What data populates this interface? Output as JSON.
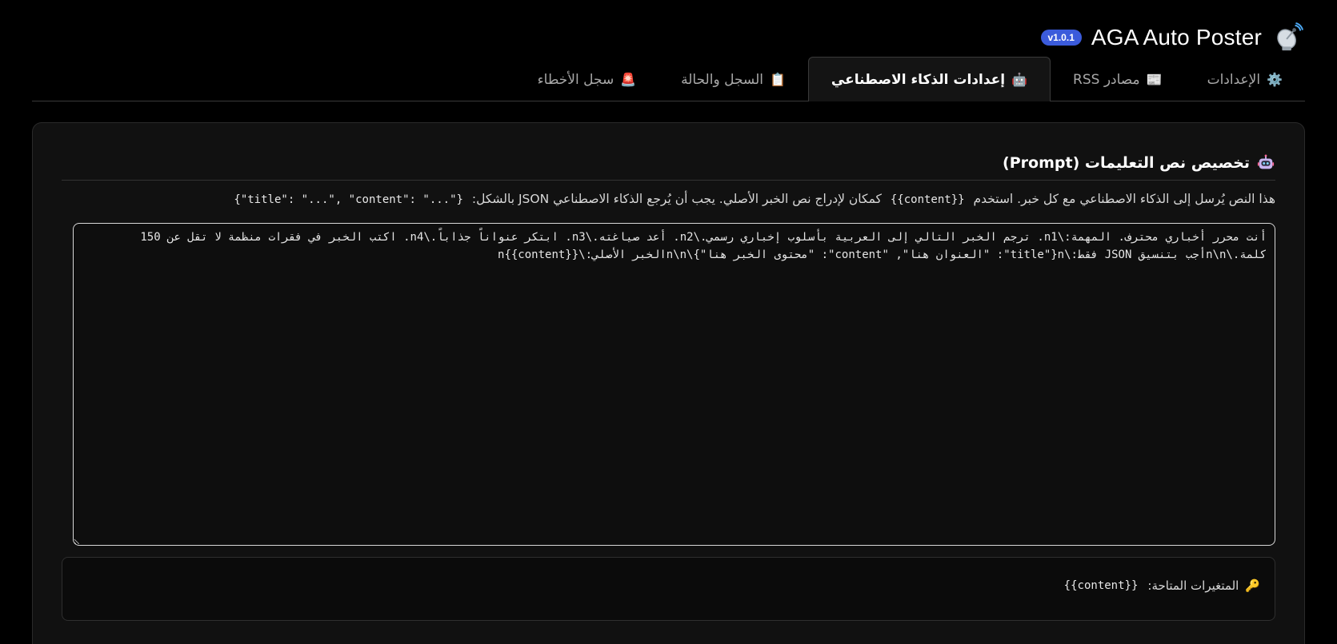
{
  "header": {
    "title": "AGA Auto Poster",
    "version": "v1.0.1",
    "icon": "satellite-dish-icon"
  },
  "tabs": [
    {
      "id": "settings",
      "label": "الإعدادات",
      "icon": "⚙️",
      "active": false
    },
    {
      "id": "rss",
      "label": "مصادر RSS",
      "icon": "📰",
      "active": false
    },
    {
      "id": "ai",
      "label": "إعدادات الذكاء الاصطناعي",
      "icon": "🤖",
      "active": true
    },
    {
      "id": "log",
      "label": "السجل والحالة",
      "icon": "📋",
      "active": false
    },
    {
      "id": "errors",
      "label": "سجل الأخطاء",
      "icon": "🚨",
      "active": false
    }
  ],
  "section": {
    "title": "تخصيص نص التعليمات (Prompt)",
    "icon": "robot-icon",
    "description": {
      "part1": "هذا النص يُرسل إلى الذكاء الاصطناعي مع كل خبر. استخدم",
      "placeholder": "{{content}}",
      "part2": "كمكان لإدراج نص الخبر الأصلي. يجب أن يُرجع الذكاء الاصطناعي JSON بالشكل:",
      "json_format": "{\"title\": \"...\", \"content\": \"...\"}"
    }
  },
  "prompt": {
    "value": "أنت محرر أخباري محترف. المهمة:\\n1. ترجم الخبر التالي إلى العربية بأسلوب إخباري رسمي.\\n2. أعد صياغته.\\n3. ابتكر عنواناً جذاباً.\\n4. اكتب الخبر في فقرات منظمة لا تقل عن 150 كلمة.\\n\\nأجب بتنسيق JSON فقط:\\n{\"title\": \"العنوان هنا\", \"content\": \"محتوى الخبر هنا\"}\\n\\nالخبر الأصلي:\\n{{content}}"
  },
  "variables": {
    "label": "المتغيرات المتاحة:",
    "icon": "🔑",
    "items": "{{content}}"
  },
  "colors": {
    "background": "#000000",
    "panel": "#111111",
    "badge": "#3b5bdb",
    "text": "#e6e6e6"
  }
}
